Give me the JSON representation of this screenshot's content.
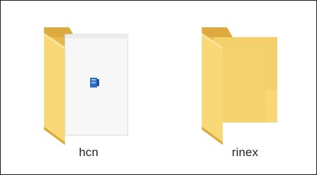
{
  "folders": [
    {
      "name": "hcn",
      "icon": "folder-with-document-icon"
    },
    {
      "name": "rinex",
      "icon": "folder-icon"
    }
  ],
  "colors": {
    "folder_back": "#e6b84e",
    "folder_front": "#f8d775",
    "folder_shade": "#d9a93c",
    "paper": "#f7f7f7",
    "paper_edge": "#d6d6d6",
    "doc_icon": "#2b6cc4",
    "border": "#1a1a1a"
  }
}
